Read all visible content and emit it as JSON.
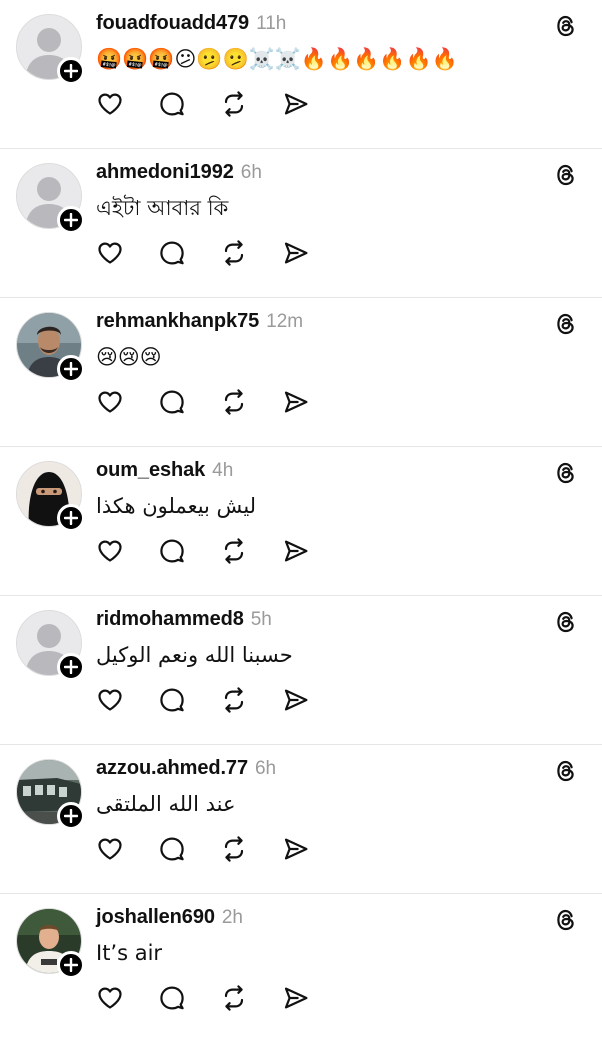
{
  "colors": {
    "text": "#111111",
    "muted": "#9a9a9a",
    "divider": "#e6e6e6",
    "badge": "#000000",
    "avatar_placeholder": "#e9e9eb"
  },
  "icons": {
    "like": "heart-icon",
    "reply": "comment-bubble-icon",
    "repost": "repost-icon",
    "share": "send-icon",
    "threads": "threads-logo-icon",
    "follow": "plus-icon"
  },
  "posts": [
    {
      "username": "fouadfouadd479",
      "time": "11h",
      "text": "🤬🤬🤬😕🫤🫤☠️☠️🔥🔥🔥🔥🔥🔥",
      "avatar": "default",
      "rtl": false
    },
    {
      "username": "ahmedoni1992",
      "time": "6h",
      "text": "এইটা আবার কি",
      "avatar": "default",
      "rtl": false
    },
    {
      "username": "rehmankhanpk75",
      "time": "12m",
      "text": "😢😢😢",
      "avatar": "photo-man",
      "rtl": false
    },
    {
      "username": "oum_eshak",
      "time": "4h",
      "text": "ليش بيعملون هكذا",
      "avatar": "photo-niqab",
      "rtl": true
    },
    {
      "username": "ridmohammed8",
      "time": "5h",
      "text": "حسبنا الله ونعم الوكيل",
      "avatar": "default",
      "rtl": true
    },
    {
      "username": "azzou.ahmed.77",
      "time": "6h",
      "text": "عند الله الملتقى",
      "avatar": "photo-train",
      "rtl": true
    },
    {
      "username": "joshallen690",
      "time": "2h",
      "text": "It’s air",
      "avatar": "photo-player",
      "rtl": false
    }
  ]
}
